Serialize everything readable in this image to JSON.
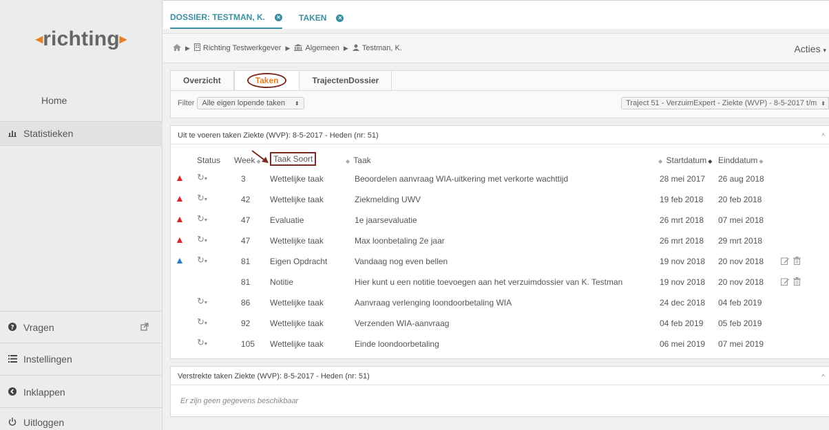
{
  "brand": {
    "name": "richting"
  },
  "sidebar": {
    "home": "Home",
    "statistieken": "Statistieken",
    "vragen": "Vragen",
    "instellingen": "Instellingen",
    "inklappen": "Inklappen",
    "uitloggen": "Uitloggen"
  },
  "tabs": [
    {
      "label": "DOSSIER: TESTMAN, K."
    },
    {
      "label": "TAKEN"
    }
  ],
  "breadcrumb": {
    "employer": "Richting Testwerkgever",
    "dept": "Algemeen",
    "person": "Testman, K."
  },
  "acties": "Acties",
  "subtabs": [
    "Overzicht",
    "Taken",
    "TrajectenDossier"
  ],
  "filter": {
    "label": "Filter",
    "value": "Alle eigen lopende taken",
    "traject": "Traject 51 - VerzuimExpert - Ziekte (WVP) - 8-5-2017 t/m"
  },
  "tasks_panel": {
    "title": "Uit te voeren taken Ziekte (WVP): 8-5-2017 - Heden (nr: 51)",
    "columns": {
      "status": "Status",
      "week": "Week",
      "soort": "Taak Soort",
      "taak": "Taak",
      "start": "Startdatum",
      "eind": "Einddatum"
    },
    "rows": [
      {
        "warn": "red",
        "recur": true,
        "week": "3",
        "soort": "Wettelijke taak",
        "taak": "Beoordelen aanvraag WIA-uitkering met verkorte wachttijd",
        "start": "28 mei 2017",
        "eind": "26 aug 2018",
        "actions": false
      },
      {
        "warn": "red",
        "recur": true,
        "week": "42",
        "soort": "Wettelijke taak",
        "taak": "Ziekmelding UWV",
        "start": "19 feb 2018",
        "eind": "20 feb 2018",
        "actions": false
      },
      {
        "warn": "red",
        "recur": true,
        "week": "47",
        "soort": "Evaluatie",
        "taak": "1e jaarsevaluatie",
        "start": "26 mrt 2018",
        "eind": "07 mei 2018",
        "actions": false
      },
      {
        "warn": "red",
        "recur": true,
        "week": "47",
        "soort": "Wettelijke taak",
        "taak": "Max loonbetaling 2e jaar",
        "start": "26 mrt 2018",
        "eind": "29 mrt 2018",
        "actions": false
      },
      {
        "warn": "blue",
        "recur": true,
        "week": "81",
        "soort": "Eigen Opdracht",
        "taak": "Vandaag nog even bellen",
        "start": "19 nov 2018",
        "eind": "20 nov 2018",
        "actions": true
      },
      {
        "warn": "none",
        "recur": false,
        "week": "81",
        "soort": "Notitie",
        "taak": "Hier kunt u een notitie toevoegen aan het verzuimdossier van K. Testman",
        "start": "19 nov 2018",
        "eind": "20 nov 2018",
        "actions": true
      },
      {
        "warn": "none",
        "recur": true,
        "week": "86",
        "soort": "Wettelijke taak",
        "taak": "Aanvraag verlenging loondoorbetaling WIA",
        "start": "24 dec 2018",
        "eind": "04 feb 2019",
        "actions": false
      },
      {
        "warn": "none",
        "recur": true,
        "week": "92",
        "soort": "Wettelijke taak",
        "taak": "Verzenden WIA-aanvraag",
        "start": "04 feb 2019",
        "eind": "05 feb 2019",
        "actions": false
      },
      {
        "warn": "none",
        "recur": true,
        "week": "105",
        "soort": "Wettelijke taak",
        "taak": "Einde loondoorbetaling",
        "start": "06 mei 2019",
        "eind": "07 mei 2019",
        "actions": false
      }
    ]
  },
  "expired_panel": {
    "title": "Verstrekte taken Ziekte (WVP): 8-5-2017 - Heden (nr: 51)",
    "empty": "Er zijn geen gegevens beschikbaar"
  },
  "colors": {
    "accent": "#3a8fa0",
    "orange": "#e67e22",
    "alert_red": "#d9262c",
    "alert_blue": "#2a7ad0"
  }
}
